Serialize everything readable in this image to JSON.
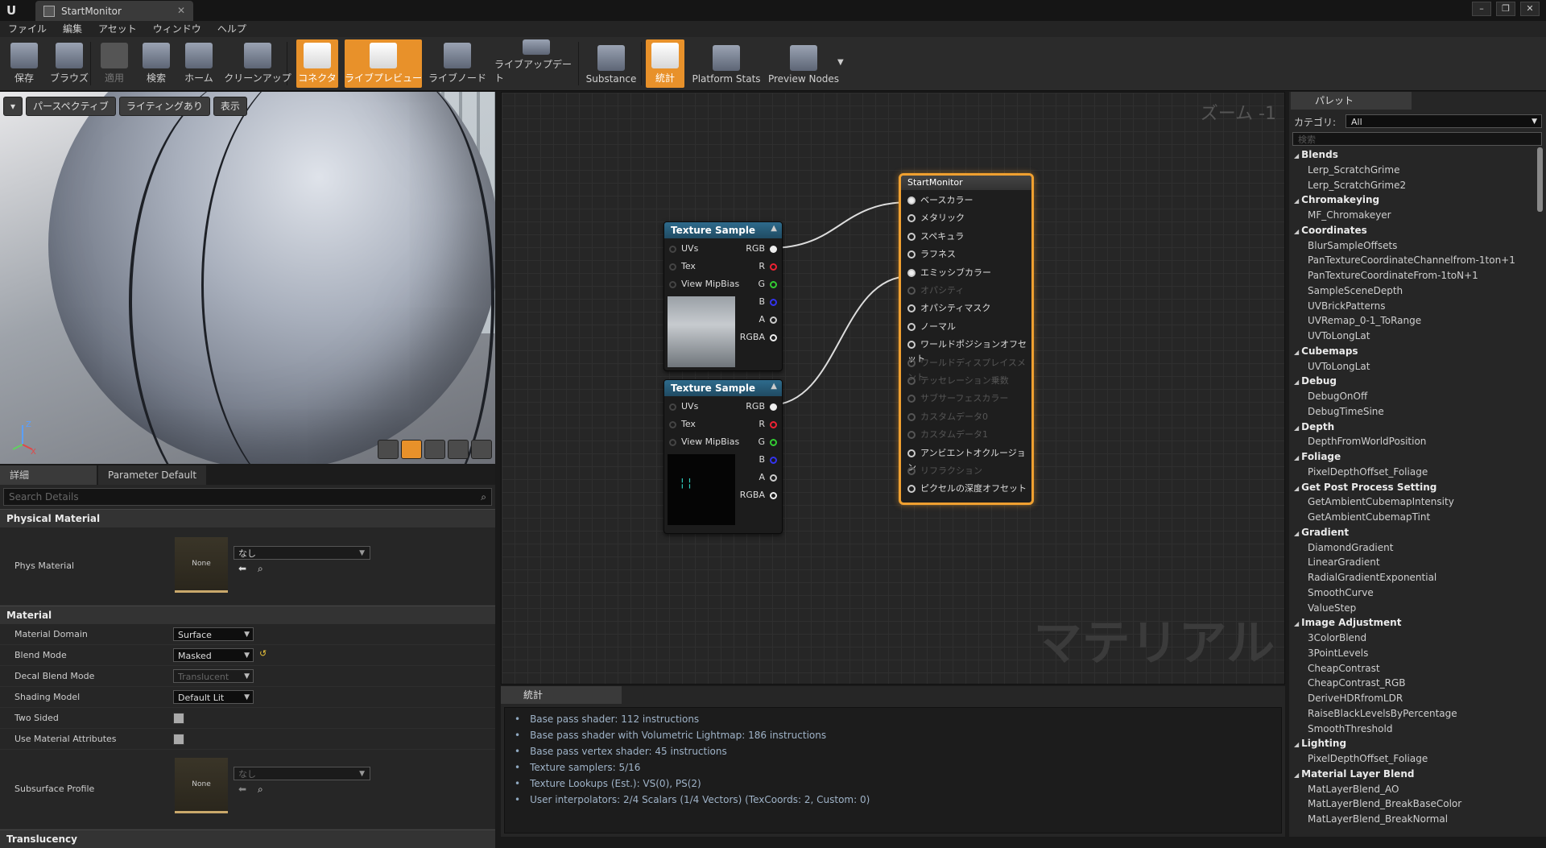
{
  "window": {
    "tab_title": "StartMonitor"
  },
  "menu": [
    "ファイル",
    "編集",
    "アセット",
    "ウィンドウ",
    "ヘルプ"
  ],
  "toolbar": [
    {
      "label": "保存",
      "icon": "save-icon",
      "state": "normal"
    },
    {
      "label": "ブラウズ",
      "icon": "browse-icon",
      "state": "normal"
    },
    {
      "label": "適用",
      "icon": "apply-icon",
      "state": "disabled"
    },
    {
      "label": "検索",
      "icon": "search-icon",
      "state": "normal"
    },
    {
      "label": "ホーム",
      "icon": "home-icon",
      "state": "normal"
    },
    {
      "label": "クリーンアップ",
      "icon": "cleanup-icon",
      "state": "normal"
    },
    {
      "label": "コネクタ",
      "icon": "connector-icon",
      "state": "active"
    },
    {
      "label": "ライブプレビュー",
      "icon": "live-preview-icon",
      "state": "active"
    },
    {
      "label": "ライブノード",
      "icon": "live-node-icon",
      "state": "normal"
    },
    {
      "label": "ライブアップデート",
      "icon": "live-update-icon",
      "state": "normal"
    },
    {
      "label": "Substance",
      "icon": "substance-icon",
      "state": "normal"
    },
    {
      "label": "統計",
      "icon": "stats-icon",
      "state": "active"
    },
    {
      "label": "Platform Stats",
      "icon": "platform-stats-icon",
      "state": "normal"
    },
    {
      "label": "Preview Nodes",
      "icon": "preview-nodes-icon",
      "state": "normal"
    }
  ],
  "viewport": {
    "perspective": "パースペクティブ",
    "lighting": "ライティングあり",
    "show": "表示"
  },
  "details": {
    "tabs": [
      "詳細",
      "Parameter Default"
    ],
    "search_placeholder": "Search Details",
    "categories": {
      "physical": "Physical Material",
      "material": "Material",
      "translucency": "Translucency"
    },
    "phys_material": {
      "label": "Phys Material",
      "thumb": "None",
      "value": "なし"
    },
    "rows": [
      {
        "label": "Material Domain",
        "value": "Surface",
        "enabled": true
      },
      {
        "label": "Blend Mode",
        "value": "Masked",
        "enabled": true
      },
      {
        "label": "Decal Blend Mode",
        "value": "Translucent",
        "enabled": false
      },
      {
        "label": "Shading Model",
        "value": "Default Lit",
        "enabled": true
      }
    ],
    "two_sided": "Two Sided",
    "use_material_attributes": "Use Material Attributes",
    "subsurface": {
      "label": "Subsurface Profile",
      "thumb": "None",
      "value": "なし"
    }
  },
  "graph": {
    "zoom": "ズーム -1",
    "watermark": "マテリアル",
    "nodes": [
      {
        "title": "Texture Sample",
        "inputs": [
          "UVs",
          "Tex",
          "View MipBias"
        ],
        "outputs": [
          "RGB",
          "R",
          "G",
          "B",
          "A",
          "RGBA"
        ]
      },
      {
        "title": "Texture Sample",
        "inputs": [
          "UVs",
          "Tex",
          "View MipBias"
        ],
        "outputs": [
          "RGB",
          "R",
          "G",
          "B",
          "A",
          "RGBA"
        ]
      }
    ],
    "result": {
      "title": "StartMonitor",
      "pins": [
        {
          "label": "ベースカラー",
          "enabled": true
        },
        {
          "label": "メタリック",
          "enabled": true
        },
        {
          "label": "スペキュラ",
          "enabled": true
        },
        {
          "label": "ラフネス",
          "enabled": true
        },
        {
          "label": "エミッシブカラー",
          "enabled": true
        },
        {
          "label": "オパシティ",
          "enabled": false
        },
        {
          "label": "オパシティマスク",
          "enabled": true
        },
        {
          "label": "ノーマル",
          "enabled": true
        },
        {
          "label": "ワールドポジションオフセット",
          "enabled": true
        },
        {
          "label": "ワールドディスプレイスメント",
          "enabled": false
        },
        {
          "label": "テッセレーション乗数",
          "enabled": false
        },
        {
          "label": "サブサーフェスカラー",
          "enabled": false
        },
        {
          "label": "カスタムデータ0",
          "enabled": false
        },
        {
          "label": "カスタムデータ1",
          "enabled": false
        },
        {
          "label": "アンビエントオクルージョン",
          "enabled": true
        },
        {
          "label": "リフラクション",
          "enabled": false
        },
        {
          "label": "ピクセルの深度オフセット",
          "enabled": true
        }
      ]
    }
  },
  "stats": {
    "tab": "統計",
    "lines": [
      "Base pass shader: 112 instructions",
      "Base pass shader with Volumetric Lightmap: 186 instructions",
      "Base pass vertex shader: 45 instructions",
      "Texture samplers: 5/16",
      "Texture Lookups (Est.): VS(0), PS(2)",
      "User interpolators: 2/4 Scalars (1/4 Vectors) (TexCoords: 2, Custom: 0)"
    ]
  },
  "palette": {
    "tab": "パレット",
    "category_label": "カテゴリ:",
    "category_value": "All",
    "search_placeholder": "検索",
    "groups": [
      {
        "name": "Blends",
        "items": [
          "Lerp_ScratchGrime",
          "Lerp_ScratchGrime2"
        ]
      },
      {
        "name": "Chromakeying",
        "items": [
          "MF_Chromakeyer"
        ]
      },
      {
        "name": "Coordinates",
        "items": [
          "BlurSampleOffsets",
          "PanTextureCoordinateChannelfrom-1ton+1",
          "PanTextureCoordinateFrom-1toN+1",
          "SampleSceneDepth",
          "UVBrickPatterns",
          "UVRemap_0-1_ToRange",
          "UVToLongLat"
        ]
      },
      {
        "name": "Cubemaps",
        "items": [
          "UVToLongLat"
        ]
      },
      {
        "name": "Debug",
        "items": [
          "DebugOnOff",
          "DebugTimeSine"
        ]
      },
      {
        "name": "Depth",
        "items": [
          "DepthFromWorldPosition"
        ]
      },
      {
        "name": "Foliage",
        "items": [
          "PixelDepthOffset_Foliage"
        ]
      },
      {
        "name": "Get Post Process Setting",
        "items": [
          "GetAmbientCubemapIntensity",
          "GetAmbientCubemapTint"
        ]
      },
      {
        "name": "Gradient",
        "items": [
          "DiamondGradient",
          "LinearGradient",
          "RadialGradientExponential",
          "SmoothCurve",
          "ValueStep"
        ]
      },
      {
        "name": "Image Adjustment",
        "items": [
          "3ColorBlend",
          "3PointLevels",
          "CheapContrast",
          "CheapContrast_RGB",
          "DeriveHDRfromLDR",
          "RaiseBlackLevelsByPercentage",
          "SmoothThreshold"
        ]
      },
      {
        "name": "Lighting",
        "items": [
          "PixelDepthOffset_Foliage"
        ]
      },
      {
        "name": "Material Layer Blend",
        "items": [
          "MatLayerBlend_AO",
          "MatLayerBlend_BreakBaseColor",
          "MatLayerBlend_BreakNormal"
        ]
      }
    ]
  }
}
